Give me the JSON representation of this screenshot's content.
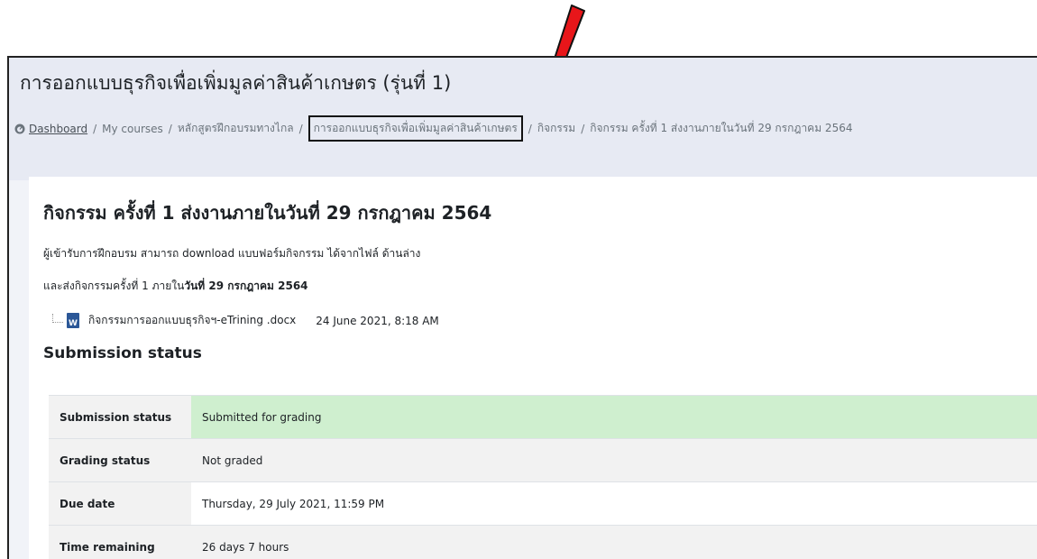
{
  "course": {
    "title": "การออกแบบธุรกิจเพื่อเพิ่มมูลค่าสินค้าเกษตร (รุ่นที่ 1)"
  },
  "breadcrumb": {
    "icon": "dashboard-icon",
    "items": [
      "Dashboard",
      "My courses",
      "หลักสูตรฝึกอบรมทางไกล",
      "การออกแบบธุรกิจเพื่อเพิ่มมูลค่าสินค้าเกษตร",
      "กิจกรรม",
      "กิจกรรม ครั้งที่ 1 ส่งงานภายในวันที่ 29 กรกฎาคม 2564"
    ],
    "separator": "/"
  },
  "activity": {
    "title": "กิจกรรม ครั้งที่ 1 ส่งงานภายในวันที่ 29 กรกฎาคม 2564",
    "intro_line1": "ผู้เข้ารับการฝึกอบรม สามารถ download แบบฟอร์มกิจกรรม ได้จากไฟล์ ด้านล่าง",
    "intro_line2_prefix": "และส่งกิจกรรมครั้งที่ 1 ภายใน",
    "intro_line2_bold": "วันที่ 29 กรกฎาคม 2564",
    "file": {
      "icon": "word-document-icon",
      "icon_letter": "W",
      "name": "กิจกรรมการออกแบบธุรกิจฯ-eTrining .docx",
      "date": "24 June 2021, 8:18 AM"
    }
  },
  "submission": {
    "heading": "Submission status",
    "rows": [
      {
        "label": "Submission status",
        "value": "Submitted for grading"
      },
      {
        "label": "Grading status",
        "value": "Not graded"
      },
      {
        "label": "Due date",
        "value": "Thursday, 29 July 2021, 11:59 PM"
      },
      {
        "label": "Time remaining",
        "value": "26 days 7 hours"
      }
    ]
  },
  "colors": {
    "header_bg": "#e7eaf3",
    "submitted_bg": "#cfefcf",
    "arrow": "#e8161a",
    "word_blue": "#2b5797"
  },
  "annotation": {
    "icon": "red-arrow-icon"
  }
}
